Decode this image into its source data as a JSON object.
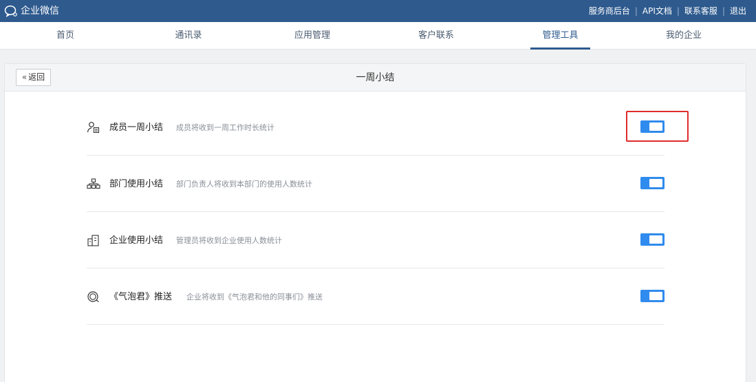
{
  "app": {
    "name": "企业微信"
  },
  "top_links": [
    "服务商后台",
    "API文档",
    "联系客服",
    "退出"
  ],
  "nav": [
    {
      "label": "首页"
    },
    {
      "label": "通讯录"
    },
    {
      "label": "应用管理"
    },
    {
      "label": "客户联系"
    },
    {
      "label": "管理工具",
      "active": true
    },
    {
      "label": "我的企业"
    }
  ],
  "panel": {
    "back_label": "返回",
    "title": "一周小结"
  },
  "settings": [
    {
      "icon": "member-icon",
      "name": "成员一周小结",
      "desc": "成员将收到一周工作时长统计",
      "enabled": true
    },
    {
      "icon": "org-chart-icon",
      "name": "部门使用小结",
      "desc": "部门负责人将收到本部门的使用人数统计",
      "enabled": true
    },
    {
      "icon": "building-icon",
      "name": "企业使用小结",
      "desc": "管理员将收到企业使用人数统计",
      "enabled": true
    },
    {
      "icon": "bubble-icon",
      "name": "《气泡君》推送",
      "desc": "企业将收到《气泡君和他的同事们》推送",
      "enabled": true
    }
  ],
  "colors": {
    "topbar": "#2e5a8e",
    "toggle_on": "#2f8bed",
    "highlight": "#e02a2a"
  }
}
